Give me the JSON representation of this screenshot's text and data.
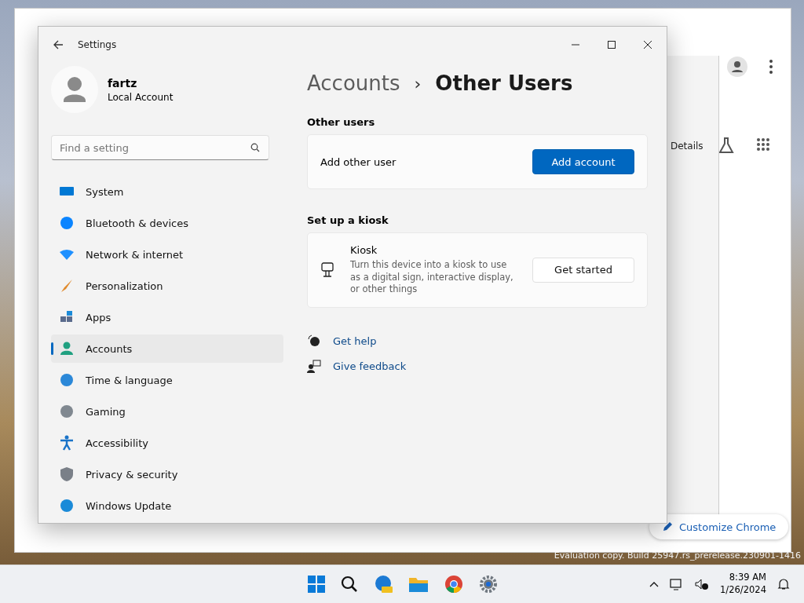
{
  "browser": {
    "side_panel": {
      "tab": "Details"
    },
    "customize_button": "Customize Chrome"
  },
  "settings": {
    "window": {
      "title": "Settings"
    },
    "user": {
      "name": "fartz",
      "account_type": "Local Account"
    },
    "search": {
      "placeholder": "Find a setting"
    },
    "nav": [
      {
        "label": "System",
        "selected": false
      },
      {
        "label": "Bluetooth & devices",
        "selected": false
      },
      {
        "label": "Network & internet",
        "selected": false
      },
      {
        "label": "Personalization",
        "selected": false
      },
      {
        "label": "Apps",
        "selected": false
      },
      {
        "label": "Accounts",
        "selected": true
      },
      {
        "label": "Time & language",
        "selected": false
      },
      {
        "label": "Gaming",
        "selected": false
      },
      {
        "label": "Accessibility",
        "selected": false
      },
      {
        "label": "Privacy & security",
        "selected": false
      },
      {
        "label": "Windows Update",
        "selected": false
      }
    ],
    "breadcrumb": {
      "parent": "Accounts",
      "separator": "›",
      "current": "Other Users"
    },
    "sections": [
      {
        "heading": "Other users",
        "card": {
          "label": "Add other user",
          "button": "Add account",
          "primary": true
        }
      },
      {
        "heading": "Set up a kiosk",
        "card": {
          "title": "Kiosk",
          "description": "Turn this device into a kiosk to use as a digital sign, interactive display, or other things",
          "button": "Get started",
          "primary": false
        }
      }
    ],
    "links": [
      "Get help",
      "Give feedback"
    ]
  },
  "watermark": "Evaluation copy. Build 25947.rs_prerelease.230901-1416",
  "taskbar": {
    "time": "8:39 AM",
    "date": "1/26/2024"
  }
}
